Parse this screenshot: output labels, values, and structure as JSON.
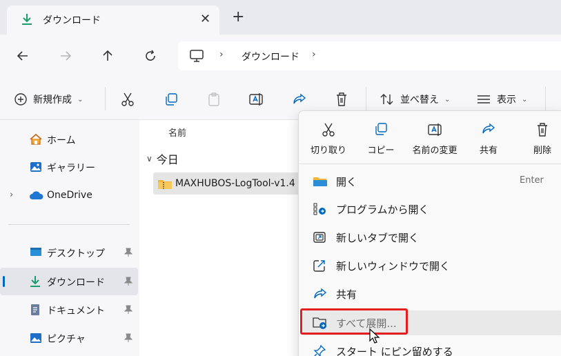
{
  "tab": {
    "title": "ダウンロード",
    "close": "✕",
    "new_tab": "+"
  },
  "address": {
    "crumb": "ダウンロード",
    "sep": "›"
  },
  "commands": {
    "new": "新規作成",
    "sort": "並べ替え",
    "view": "表示"
  },
  "sidebar": {
    "items": [
      {
        "label": "ホーム"
      },
      {
        "label": "ギャラリー"
      },
      {
        "label": "OneDrive"
      },
      {
        "label": "デスクトップ"
      },
      {
        "label": "ダウンロード"
      },
      {
        "label": "ドキュメント"
      },
      {
        "label": "ピクチャ"
      }
    ]
  },
  "main": {
    "column_name": "名前",
    "group": "今日",
    "file": "MAXHUBOS-LogTool-v1.4"
  },
  "context_menu": {
    "quick": [
      {
        "label": "切り取り",
        "icon": "cut-icon"
      },
      {
        "label": "コピー",
        "icon": "copy-icon"
      },
      {
        "label": "名前の変更",
        "icon": "rename-icon"
      },
      {
        "label": "共有",
        "icon": "share-icon"
      },
      {
        "label": "削除",
        "icon": "delete-icon"
      }
    ],
    "items": [
      {
        "label": "開く",
        "shortcut": "Enter"
      },
      {
        "label": "プログラムから開く"
      },
      {
        "label": "新しいタブで開く"
      },
      {
        "label": "新しいウィンドウで開く"
      },
      {
        "label": "共有"
      },
      {
        "label": "すべて展開..."
      },
      {
        "label": "スタート にピン留めする"
      }
    ]
  },
  "colors": {
    "accent": "#0067c0",
    "highlight": "#e41e1e",
    "download_green": "#1a9c6c"
  }
}
